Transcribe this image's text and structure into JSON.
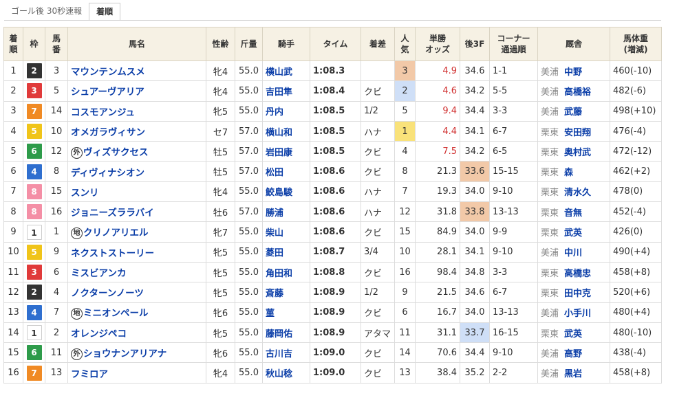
{
  "tabs": [
    "ゴール後 30秒速報",
    "着順"
  ],
  "headers": {
    "rank": "着\n順",
    "waku": "枠",
    "umaban": "馬\n番",
    "name": "馬名",
    "sexage": "性齢",
    "weight": "斤量",
    "jockey": "騎手",
    "time": "タイム",
    "margin": "着差",
    "pop": "人\n気",
    "odds": "単勝\nオッズ",
    "last3f": "後3F",
    "corner": "コーナー\n通過順",
    "trainer": "厩舎",
    "body": "馬体重\n(増減)"
  },
  "rows": [
    {
      "rank": "1",
      "waku": "2",
      "umaban": "3",
      "mark": "",
      "name": "マウンテンムスメ",
      "sexage": "牝4",
      "weight": "55.0",
      "jockey": "横山武",
      "time": "1:08.3",
      "margin": "",
      "pop": "3",
      "odds": "4.9",
      "last3f": "34.6",
      "corner": "1-1",
      "loc": "美浦",
      "trainer": "中野",
      "body": "460(-10)"
    },
    {
      "rank": "2",
      "waku": "3",
      "umaban": "5",
      "mark": "",
      "name": "シュアーヴアリア",
      "sexage": "牝4",
      "weight": "55.0",
      "jockey": "吉田隼",
      "time": "1:08.4",
      "margin": "クビ",
      "pop": "2",
      "odds": "4.6",
      "last3f": "34.2",
      "corner": "5-5",
      "loc": "美浦",
      "trainer": "高橋裕",
      "body": "482(-6)"
    },
    {
      "rank": "3",
      "waku": "7",
      "umaban": "14",
      "mark": "",
      "name": "コスモアンジュ",
      "sexage": "牝5",
      "weight": "55.0",
      "jockey": "丹内",
      "time": "1:08.5",
      "margin": "1/2",
      "pop": "5",
      "odds": "9.4",
      "last3f": "34.4",
      "corner": "3-3",
      "loc": "美浦",
      "trainer": "武藤",
      "body": "498(+10)"
    },
    {
      "rank": "4",
      "waku": "5",
      "umaban": "10",
      "mark": "",
      "name": "オメガラヴィサン",
      "sexage": "セ7",
      "weight": "57.0",
      "jockey": "横山和",
      "time": "1:08.5",
      "margin": "ハナ",
      "pop": "1",
      "odds": "4.4",
      "last3f": "34.1",
      "corner": "6-7",
      "loc": "栗東",
      "trainer": "安田翔",
      "body": "476(-4)"
    },
    {
      "rank": "5",
      "waku": "6",
      "umaban": "12",
      "mark": "外",
      "name": "ヴィズサクセス",
      "sexage": "牡5",
      "weight": "57.0",
      "jockey": "岩田康",
      "time": "1:08.5",
      "margin": "クビ",
      "pop": "4",
      "odds": "7.5",
      "last3f": "34.2",
      "corner": "6-5",
      "loc": "栗東",
      "trainer": "奥村武",
      "body": "472(-12)"
    },
    {
      "rank": "6",
      "waku": "4",
      "umaban": "8",
      "mark": "",
      "name": "ディヴィナシオン",
      "sexage": "牡5",
      "weight": "57.0",
      "jockey": "松田",
      "time": "1:08.6",
      "margin": "クビ",
      "pop": "8",
      "odds": "21.3",
      "last3f": "33.6",
      "corner": "15-15",
      "loc": "栗東",
      "trainer": "森",
      "body": "462(+2)"
    },
    {
      "rank": "7",
      "waku": "8",
      "umaban": "15",
      "mark": "",
      "name": "スンリ",
      "sexage": "牝4",
      "weight": "55.0",
      "jockey": "鮫島駿",
      "time": "1:08.6",
      "margin": "ハナ",
      "pop": "7",
      "odds": "19.3",
      "last3f": "34.0",
      "corner": "9-10",
      "loc": "栗東",
      "trainer": "清水久",
      "body": "478(0)"
    },
    {
      "rank": "8",
      "waku": "8",
      "umaban": "16",
      "mark": "",
      "name": "ジョニーズララバイ",
      "sexage": "牡6",
      "weight": "57.0",
      "jockey": "勝浦",
      "time": "1:08.6",
      "margin": "ハナ",
      "pop": "12",
      "odds": "31.8",
      "last3f": "33.8",
      "corner": "13-13",
      "loc": "栗東",
      "trainer": "音無",
      "body": "452(-4)"
    },
    {
      "rank": "9",
      "waku": "1",
      "umaban": "1",
      "mark": "地",
      "name": "クリノアリエル",
      "sexage": "牝7",
      "weight": "55.0",
      "jockey": "柴山",
      "time": "1:08.6",
      "margin": "クビ",
      "pop": "15",
      "odds": "84.9",
      "last3f": "34.0",
      "corner": "9-9",
      "loc": "栗東",
      "trainer": "武英",
      "body": "426(0)"
    },
    {
      "rank": "10",
      "waku": "5",
      "umaban": "9",
      "mark": "",
      "name": "ネクストストーリー",
      "sexage": "牝5",
      "weight": "55.0",
      "jockey": "菱田",
      "time": "1:08.7",
      "margin": "3/4",
      "pop": "10",
      "odds": "28.1",
      "last3f": "34.1",
      "corner": "9-10",
      "loc": "美浦",
      "trainer": "中川",
      "body": "490(+4)"
    },
    {
      "rank": "11",
      "waku": "3",
      "umaban": "6",
      "mark": "",
      "name": "ミスビアンカ",
      "sexage": "牝5",
      "weight": "55.0",
      "jockey": "角田和",
      "time": "1:08.8",
      "margin": "クビ",
      "pop": "16",
      "odds": "98.4",
      "last3f": "34.8",
      "corner": "3-3",
      "loc": "栗東",
      "trainer": "高橋忠",
      "body": "458(+8)"
    },
    {
      "rank": "12",
      "waku": "2",
      "umaban": "4",
      "mark": "",
      "name": "ノクターンノーツ",
      "sexage": "牝5",
      "weight": "55.0",
      "jockey": "斎藤",
      "time": "1:08.9",
      "margin": "1/2",
      "pop": "9",
      "odds": "21.5",
      "last3f": "34.6",
      "corner": "6-7",
      "loc": "栗東",
      "trainer": "田中克",
      "body": "520(+6)"
    },
    {
      "rank": "13",
      "waku": "4",
      "umaban": "7",
      "mark": "地",
      "name": "ミニオンペール",
      "sexage": "牝6",
      "weight": "55.0",
      "jockey": "菫",
      "time": "1:08.9",
      "margin": "クビ",
      "pop": "6",
      "odds": "16.7",
      "last3f": "34.0",
      "corner": "13-13",
      "loc": "美浦",
      "trainer": "小手川",
      "body": "480(+4)"
    },
    {
      "rank": "14",
      "waku": "1",
      "umaban": "2",
      "mark": "",
      "name": "オレンジペコ",
      "sexage": "牝5",
      "weight": "55.0",
      "jockey": "藤岡佑",
      "time": "1:08.9",
      "margin": "アタマ",
      "pop": "11",
      "odds": "31.1",
      "last3f": "33.7",
      "corner": "16-15",
      "loc": "栗東",
      "trainer": "武英",
      "body": "480(-10)"
    },
    {
      "rank": "15",
      "waku": "6",
      "umaban": "11",
      "mark": "外",
      "name": "ショウナンアリアナ",
      "sexage": "牝6",
      "weight": "55.0",
      "jockey": "古川吉",
      "time": "1:09.0",
      "margin": "クビ",
      "pop": "14",
      "odds": "70.6",
      "last3f": "34.4",
      "corner": "9-10",
      "loc": "美浦",
      "trainer": "高野",
      "body": "438(-4)"
    },
    {
      "rank": "16",
      "waku": "7",
      "umaban": "13",
      "mark": "",
      "name": "フミロア",
      "sexage": "牝4",
      "weight": "55.0",
      "jockey": "秋山稔",
      "time": "1:09.0",
      "margin": "クビ",
      "pop": "13",
      "odds": "38.4",
      "last3f": "35.2",
      "corner": "2-2",
      "loc": "美浦",
      "trainer": "黒岩",
      "body": "458(+8)"
    }
  ],
  "colors": {
    "waku": {
      "1": "#ffffff",
      "2": "#333333",
      "3": "#e03a3a",
      "4": "#2f6fcf",
      "5": "#f0c419",
      "6": "#2e9b4a",
      "7": "#f08a24",
      "8": "#f48fa6"
    },
    "popular_1": "#f9e27a",
    "popular_2": "#cfdff7",
    "popular_3": "#f2c9a8",
    "fastest_last3f": "#cfdff7",
    "second_last3f": "#f2c9a8",
    "odds_highlight": "#d03030",
    "link": "#0b3ea8"
  },
  "highlights": {
    "odds_red_rows": [
      1,
      2,
      3,
      4,
      5
    ],
    "last3f_orange_rows": [
      6,
      8
    ],
    "last3f_blue_rows": [
      14
    ]
  }
}
